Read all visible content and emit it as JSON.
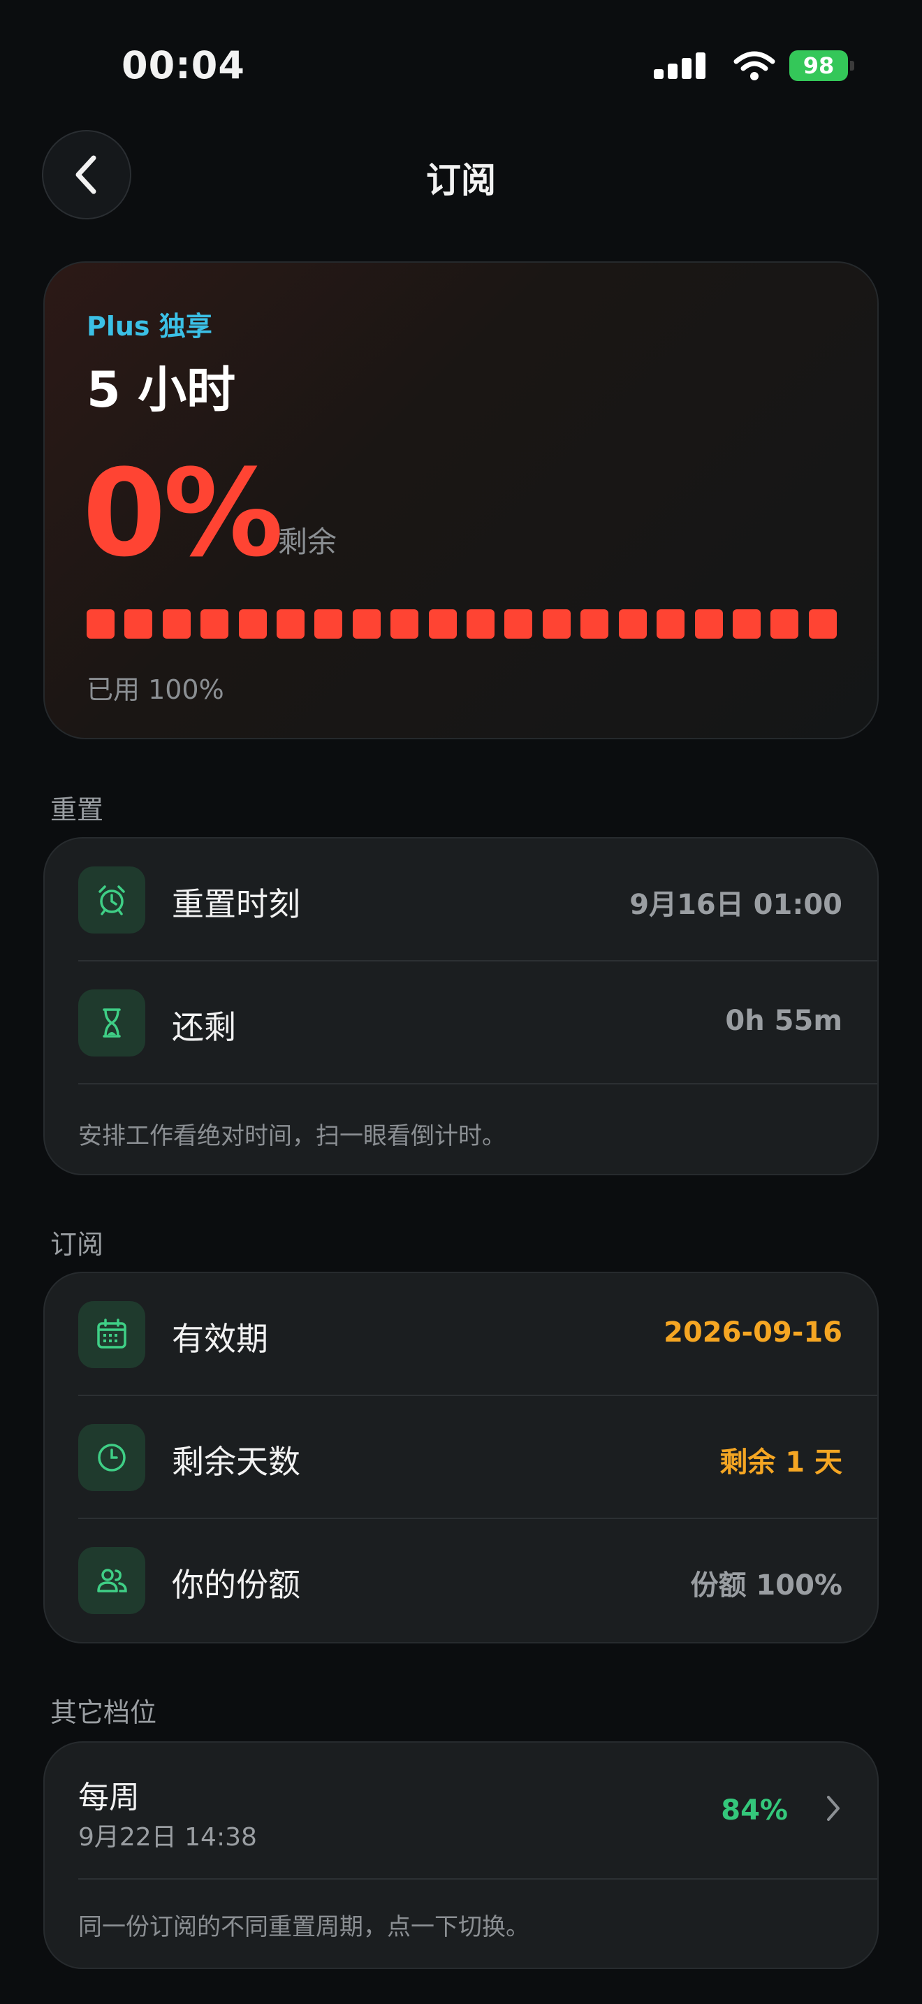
{
  "status_bar": {
    "time": "00:04",
    "battery": "98"
  },
  "header": {
    "title": "订阅"
  },
  "usage": {
    "plan_tag": "Plus 独享",
    "plan_name": "5 小时",
    "remaining_percent": "0%",
    "remaining_label": "剩余",
    "used_label": "已用 100%",
    "used_fraction": 1.0,
    "segments_total": 20,
    "accent_color": "#ff4433"
  },
  "reset": {
    "section_label": "重置",
    "rows": [
      {
        "icon": "alarm-clock-icon",
        "label": "重置时刻",
        "value": "9月16日 01:00"
      },
      {
        "icon": "hourglass-icon",
        "label": "还剩",
        "value": "0h 55m"
      }
    ],
    "note": "安排工作看绝对时间，扫一眼看倒计时。"
  },
  "subscription": {
    "section_label": "订阅",
    "rows": [
      {
        "icon": "calendar-icon",
        "label": "有效期",
        "value": "2026-09-16"
      },
      {
        "icon": "clock-icon",
        "label": "剩余天数",
        "value": "剩余 1 天"
      },
      {
        "icon": "users-icon",
        "label": "你的份额",
        "value": "份额 100%"
      }
    ]
  },
  "other_tiers": {
    "section_label": "其它档位",
    "tiers": [
      {
        "name": "每周",
        "date": "9月22日 14:38",
        "percent": "84%"
      }
    ],
    "note": "同一份订阅的不同重置周期，点一下切换。"
  },
  "colors": {
    "background": "#0b0d0f",
    "danger": "#ff4433",
    "warning": "#f5a623",
    "success": "#34c77b",
    "info": "#3bc0e6"
  }
}
